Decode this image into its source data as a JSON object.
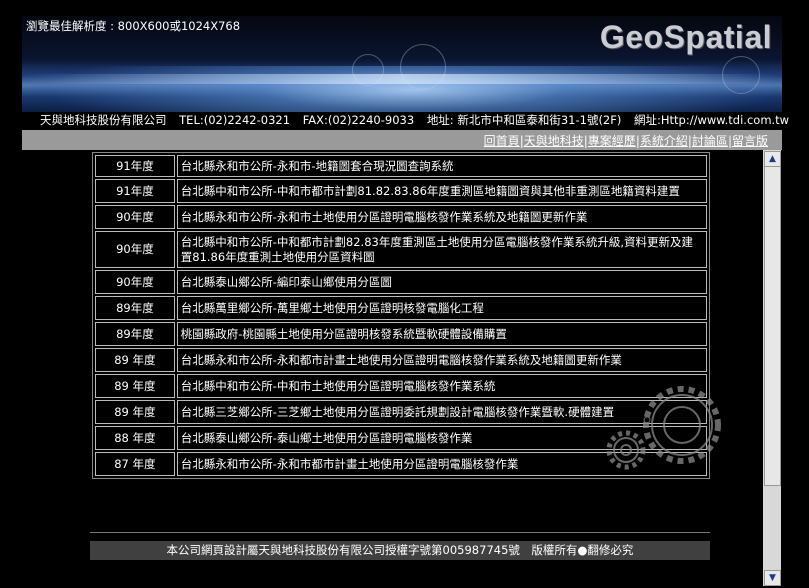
{
  "banner": {
    "resolution_note": "瀏覽最佳解析度 : 800X600或1024X768",
    "logo_text": "GeoSpatial"
  },
  "contact": {
    "company": "天與地科技股份有限公司",
    "tel": "TEL:(02)2242-0321",
    "fax": "FAX:(02)2240-9033",
    "address": "地址: 新北市中和區泰和街31-1號(2F)",
    "website": "網址:Http://www.tdi.com.tw"
  },
  "nav": {
    "items": [
      {
        "label": "回首頁"
      },
      {
        "label": "天與地科技"
      },
      {
        "label": "專案經歷"
      },
      {
        "label": "系統介紹"
      },
      {
        "label": "討論區"
      },
      {
        "label": "留言版"
      }
    ],
    "separator": "|"
  },
  "projects": [
    {
      "year": "91年度",
      "desc": "台北縣永和市公所-永和市-地籍圖套合現況圖查詢系統"
    },
    {
      "year": "91年度",
      "desc": "台北縣中和市公所-中和市都市計劃81.82.83.86年度重測區地籍圖資與其他非重測區地籍資料建置"
    },
    {
      "year": "90年度",
      "desc": "台北縣永和市公所-永和市土地使用分區證明電腦核發作業系統及地籍圖更新作業"
    },
    {
      "year": "90年度",
      "desc": "台北縣中和市公所-中和都市計劃82.83年度重測區土地使用分區電腦核發作業系統升級,資料更新及建置81.86年度重測土地使用分區資料圖"
    },
    {
      "year": "90年度",
      "desc": "台北縣泰山鄉公所-編印泰山鄉使用分區圖"
    },
    {
      "year": "89年度",
      "desc": "台北縣萬里鄉公所-萬里鄉土地使用分區證明核發電腦化工程"
    },
    {
      "year": "89年度",
      "desc": "桃園縣政府-桃園縣土地使用分區證明核發系統暨軟硬體設備購置"
    },
    {
      "year": "89 年度",
      "desc": "台北縣永和市公所-永和都市計畫土地使用分區證明電腦核發作業系統及地籍圖更新作業"
    },
    {
      "year": "89 年度",
      "desc": "台北縣中和市公所-中和市土地使用分區證明電腦核發作業系統"
    },
    {
      "year": "89 年度",
      "desc": "台北縣三芝鄉公所-三芝鄉土地使用分區證明委託規劃設計電腦核發作業暨軟.硬體建置"
    },
    {
      "year": "88 年度",
      "desc": "台北縣泰山鄉公所-泰山鄉土地使用分區證明電腦核發作業"
    },
    {
      "year": "87 年度",
      "desc": "台北縣永和市公所-永和市都市計畫土地使用分區證明電腦核發作業"
    }
  ],
  "footer": {
    "copyright": "本公司網頁設計屬天與地科技股份有限公司授權字號第005987745號　版權所有●翻修必究"
  },
  "scrollbar": {
    "up_arrow": "▲",
    "down_arrow": "▼"
  }
}
